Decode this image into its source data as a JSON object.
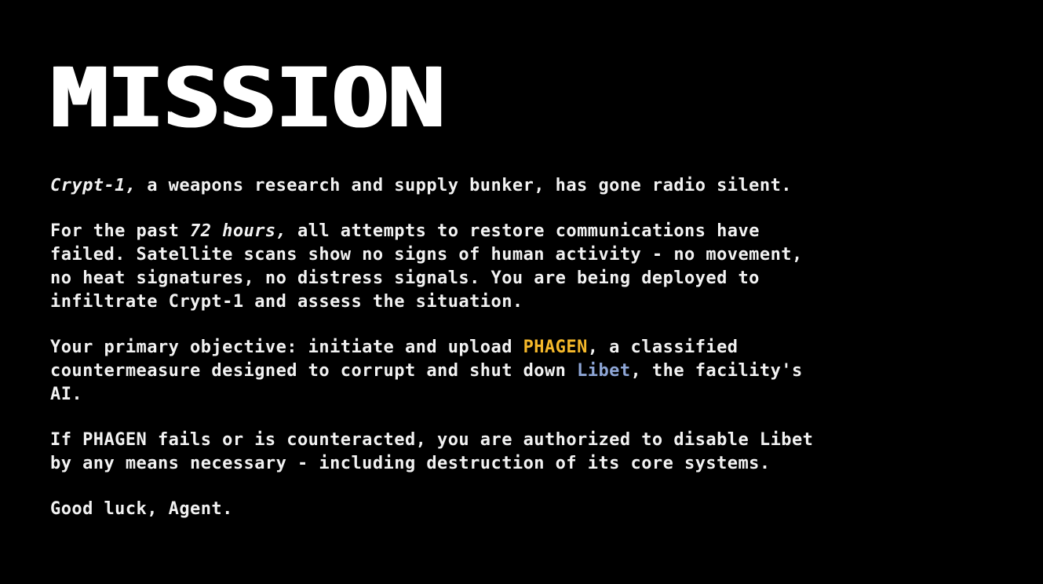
{
  "title": "MISSION",
  "paragraphs": {
    "p1": {
      "italic": "Crypt-1,",
      "rest": " a weapons research and supply bunker, has gone radio silent."
    },
    "p2": {
      "before": "For the past ",
      "italic": "72 hours,",
      "after": " all attempts to restore communications have\nfailed. Satellite scans show no signs of human activity - no movement,\nno heat signatures, no distress signals. You are being deployed to\ninfiltrate Crypt-1 and assess the situation."
    },
    "p3": {
      "before": "Your primary objective: initiate and upload ",
      "phagen": "PHAGEN",
      "middle": ", a classified\ncountermeasure designed to corrupt and shut down ",
      "libet": "Libet",
      "after": ", the facility's\nAI."
    },
    "p4": "If PHAGEN fails or is counteracted, you are authorized to disable Libet\nby any means necessary - including destruction of its core systems.",
    "p5": "Good luck, Agent."
  },
  "colors": {
    "background": "#000000",
    "text": "#f2f2f2",
    "phagen_highlight": "#f5b82a",
    "libet_highlight": "#8ea6d6"
  }
}
